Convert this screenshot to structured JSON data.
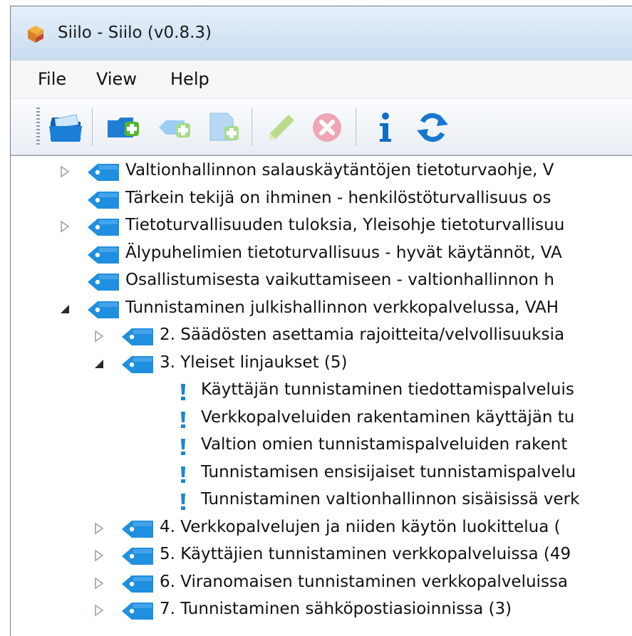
{
  "window": {
    "title": "Siilo - Siilo (v0.8.3)"
  },
  "menu": {
    "items": [
      "File",
      "View",
      "Help"
    ]
  },
  "toolbar": {
    "buttons": [
      "open-folder-icon",
      "add-folder-icon",
      "add-tag-icon",
      "add-document-icon",
      "edit-pencil-icon",
      "delete-icon",
      "info-icon",
      "refresh-icon"
    ]
  },
  "tree": {
    "rows": [
      {
        "level": 0,
        "expander": "collapsed",
        "icon": "tag",
        "label": "Valtionhallinnon salauskäytäntöjen tietoturvaohje, V"
      },
      {
        "level": 0,
        "expander": "none",
        "icon": "tag",
        "label": "Tärkein tekijä on ihminen - henkilöstöturvallisuus os"
      },
      {
        "level": 0,
        "expander": "collapsed",
        "icon": "tag",
        "label": "Tietoturvallisuuden tuloksia, Yleisohje tietoturvallisuu"
      },
      {
        "level": 0,
        "expander": "none",
        "icon": "tag",
        "label": "Älypuhelimien tietoturvallisuus - hyvät käytännöt, VA"
      },
      {
        "level": 0,
        "expander": "none",
        "icon": "tag",
        "label": "Osallistumisesta vaikuttamiseen - valtionhallinnon h"
      },
      {
        "level": 0,
        "expander": "expanded",
        "icon": "tag",
        "label": "Tunnistaminen julkishallinnon verkkopalvelussa, VAH"
      },
      {
        "level": 1,
        "expander": "collapsed",
        "icon": "tag",
        "label": "2. Säädösten asettamia rajoitteita/velvollisuuksia"
      },
      {
        "level": 1,
        "expander": "expanded",
        "icon": "tag",
        "label": "3. Yleiset linjaukset (5)"
      },
      {
        "level": 2,
        "expander": "none",
        "icon": "bang",
        "label": "Käyttäjän tunnistaminen tiedottamispalveluis"
      },
      {
        "level": 2,
        "expander": "none",
        "icon": "bang",
        "label": "Verkkopalveluiden rakentaminen käyttäjän tu"
      },
      {
        "level": 2,
        "expander": "none",
        "icon": "bang",
        "label": "Valtion omien tunnistamispalveluiden rakent"
      },
      {
        "level": 2,
        "expander": "none",
        "icon": "bang",
        "label": "Tunnistamisen ensisijaiset tunnistamispalvelu"
      },
      {
        "level": 2,
        "expander": "none",
        "icon": "bang",
        "label": "Tunnistaminen valtionhallinnon sisäisissä verk"
      },
      {
        "level": 1,
        "expander": "collapsed",
        "icon": "tag",
        "label": "4. Verkkopalvelujen ja niiden käytön luokittelua ("
      },
      {
        "level": 1,
        "expander": "collapsed",
        "icon": "tag",
        "label": "5. Käyttäjien tunnistaminen verkkopalveluissa (49"
      },
      {
        "level": 1,
        "expander": "collapsed",
        "icon": "tag",
        "label": "6. Viranomaisen tunnistaminen verkkopalveluissa"
      },
      {
        "level": 1,
        "expander": "collapsed",
        "icon": "tag",
        "label": "7. Tunnistaminen sähköpostiasioinnissa (3)"
      }
    ]
  },
  "colors": {
    "tag_blue": "#1f8fe0",
    "bang_blue": "#1a86d6",
    "window_frame": "#dbe8f5"
  }
}
